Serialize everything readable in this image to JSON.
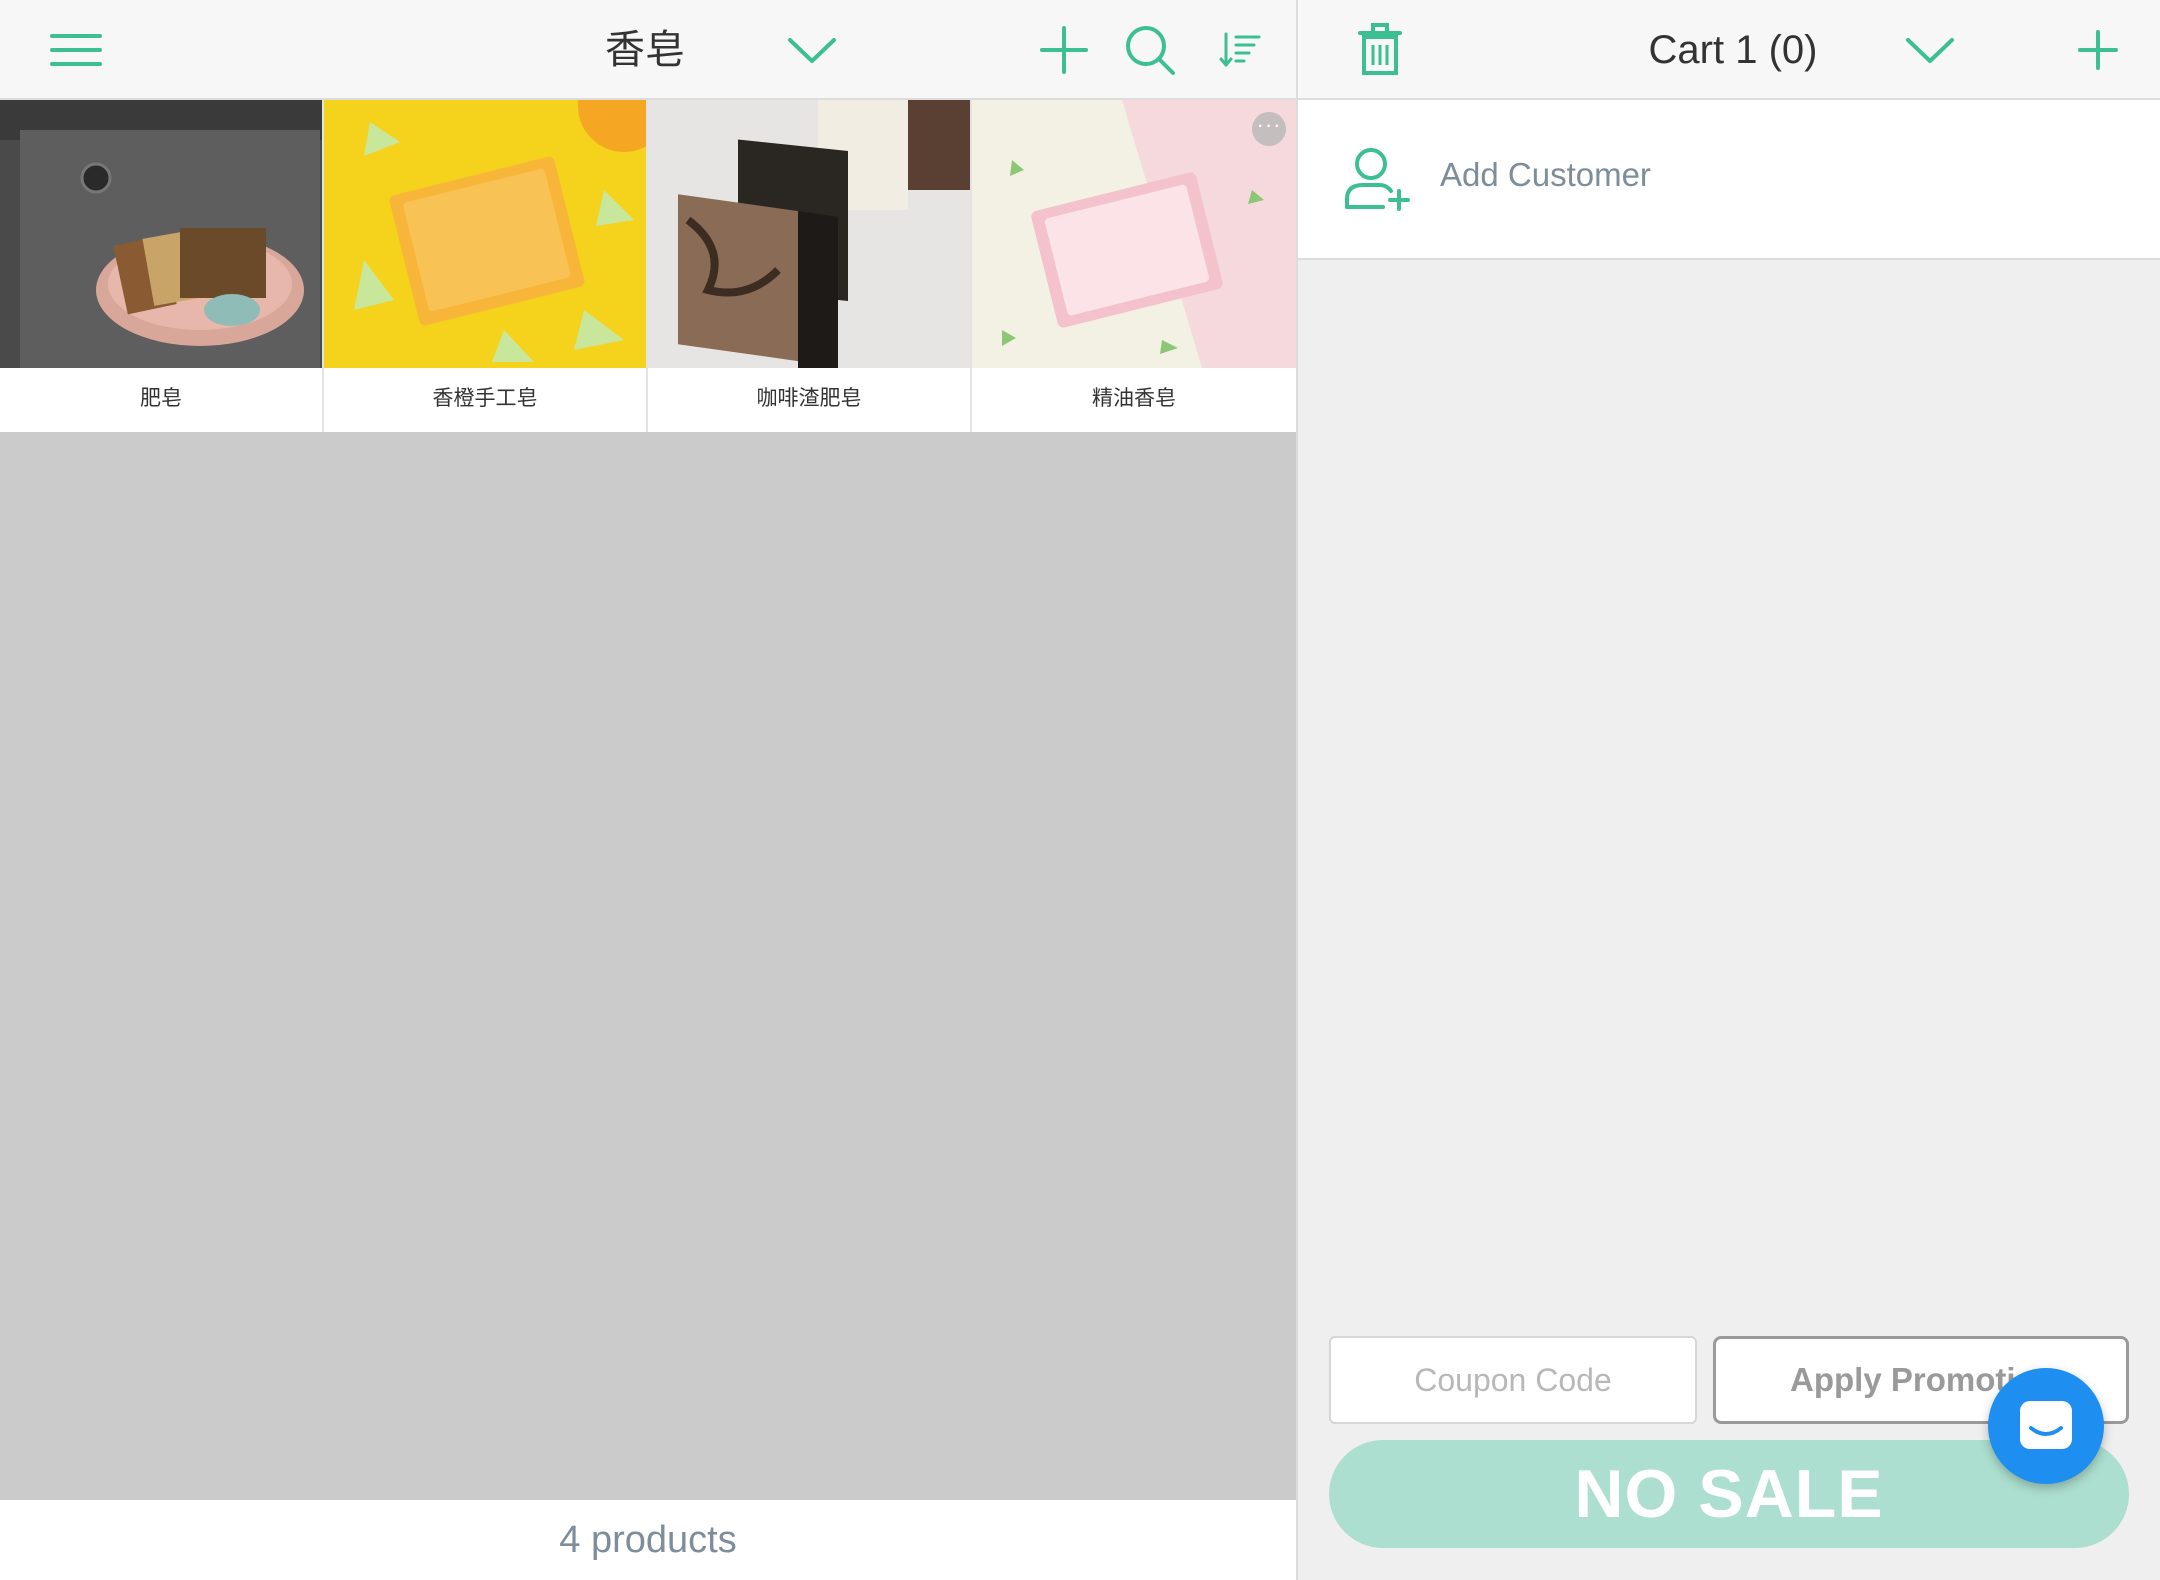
{
  "app": {
    "accent_color": "#3cbf93",
    "muted_accent": "#acdfcf"
  },
  "catalog": {
    "menu_icon": "hamburger-menu-icon",
    "category_title": "香皂",
    "category_dropdown_icon": "chevron-down-icon",
    "add_icon": "plus-icon",
    "search_icon": "search-icon",
    "sort_icon": "sort-icon",
    "products": [
      {
        "name": "肥皂"
      },
      {
        "name": "香橙手工皂"
      },
      {
        "name": "咖啡渣肥皂"
      },
      {
        "name": "精油香皂"
      }
    ],
    "more_label": "···",
    "product_count": "4 products"
  },
  "cart": {
    "delete_icon": "trash-icon",
    "title": "Cart 1 (0)",
    "dropdown_icon": "chevron-down-icon",
    "add_icon": "plus-icon",
    "add_customer_label": "Add Customer",
    "add_customer_icon": "add-user-icon",
    "coupon_placeholder": "Coupon Code",
    "coupon_value": "",
    "apply_promotion_label": "Apply Promotion",
    "no_sale_label": "NO SALE",
    "chat_icon": "chat-icon"
  }
}
